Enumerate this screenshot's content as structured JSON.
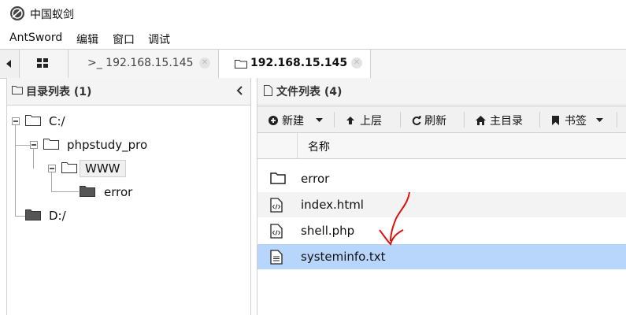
{
  "window": {
    "title": "中国蚁剑"
  },
  "menu": [
    {
      "label": "AntSword"
    },
    {
      "label": "编辑"
    },
    {
      "label": "窗口"
    },
    {
      "label": "调试"
    }
  ],
  "tabs": [
    {
      "label": ">_ 192.168.15.145",
      "icon": "terminal-icon",
      "active": false
    },
    {
      "label": "192.168.15.145",
      "icon": "folder-icon",
      "active": true
    }
  ],
  "left_panel": {
    "title": "目录列表 (1)",
    "tree": [
      {
        "label": "C:/",
        "level": 0,
        "expanded": true,
        "filled": false
      },
      {
        "label": "phpstudy_pro",
        "level": 1,
        "expanded": true,
        "filled": false
      },
      {
        "label": "WWW",
        "level": 2,
        "expanded": true,
        "filled": false,
        "selected": true
      },
      {
        "label": "error",
        "level": 3,
        "expanded": false,
        "filled": true
      },
      {
        "label": "D:/",
        "level": 0,
        "expanded": false,
        "filled": true
      }
    ]
  },
  "right_panel": {
    "title": "文件列表 (4)",
    "toolbar": {
      "new": "新建",
      "up": "上层",
      "refresh": "刷新",
      "home": "主目录",
      "bookmark": "书签"
    },
    "column_header": "名称",
    "files": [
      {
        "name": "error",
        "icon": "folder-outline-icon"
      },
      {
        "name": "index.html",
        "icon": "code-file-icon"
      },
      {
        "name": "shell.php",
        "icon": "code-file-icon"
      },
      {
        "name": "systeminfo.txt",
        "icon": "text-file-icon",
        "selected": true
      }
    ]
  },
  "colors": {
    "selection": "#b8d6fb",
    "annotation": "#e01010"
  }
}
